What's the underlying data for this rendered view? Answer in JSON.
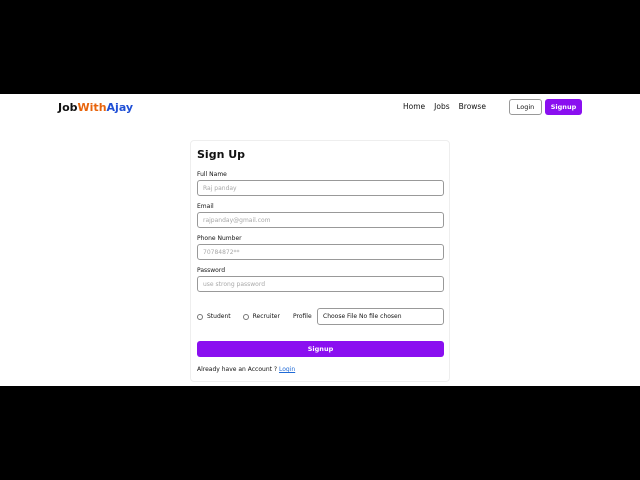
{
  "logo": {
    "part1": "Job",
    "part2": "With",
    "part3": "Ajay"
  },
  "nav": {
    "home": "Home",
    "jobs": "Jobs",
    "browse": "Browse",
    "login": "Login",
    "signup": "Signup"
  },
  "form": {
    "title": "Sign Up",
    "full_name_label": "Full Name",
    "full_name_placeholder": "Raj panday",
    "email_label": "Email",
    "email_placeholder": "rajpanday@gmail.com",
    "phone_label": "Phone Number",
    "phone_placeholder": "70784872**",
    "password_label": "Password",
    "password_placeholder": "use strong password",
    "role_student": "Student",
    "role_recruiter": "Recruiter",
    "profile_label": "Profile",
    "file_button": "Choose File",
    "file_status": "No file chosen",
    "submit_label": "Signup",
    "footer_prefix": "Already have an Account ?",
    "footer_link": "Login"
  },
  "colors": {
    "accent": "#8a0ff0",
    "logo_orange": "#e8640c",
    "logo_blue": "#1f4fd6"
  }
}
